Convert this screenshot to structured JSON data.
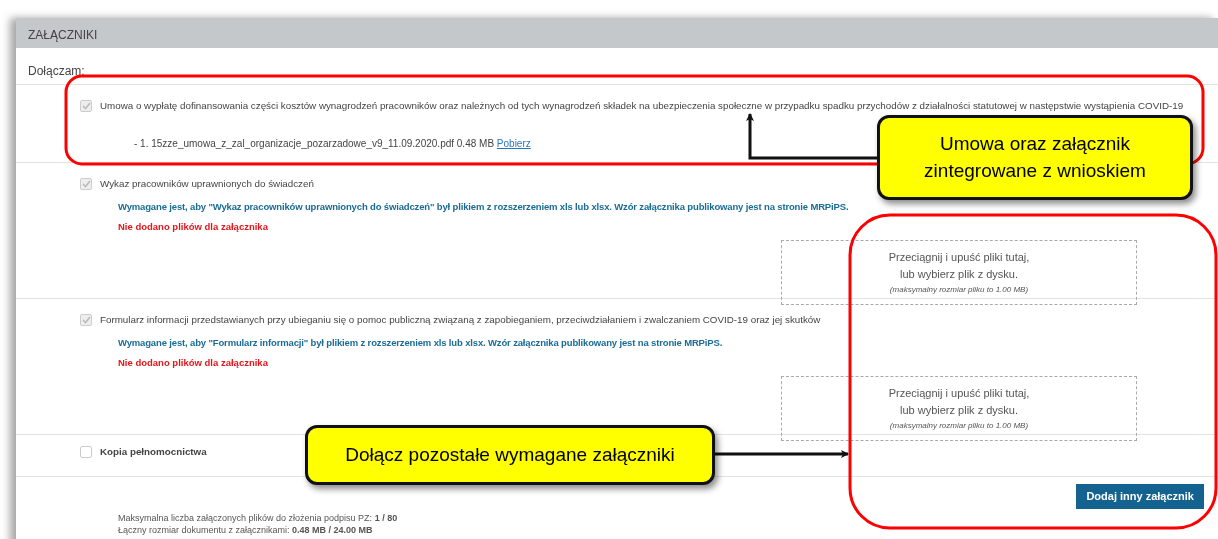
{
  "section": {
    "title": "ZAŁĄCZNIKI",
    "intro": "Dołączam:"
  },
  "attachments": [
    {
      "label": "Umowa o wypłatę dofinansowania części kosztów wynagrodzeń pracowników oraz należnych od tych wynagrodzeń składek na ubezpieczenia społeczne w przypadku spadku przychodów z działalności statutowej w następstwie wystąpienia COVID-19",
      "checked": true,
      "disabled": true,
      "files": [
        {
          "name": "- 1. 15zze_umowa_z_zal_organizacje_pozarzadowe_v9_11.09.2020.pdf 0.48 MB",
          "link": "Pobierz"
        }
      ]
    },
    {
      "label": "Wykaz pracowników uprawnionych do świadczeń",
      "checked": true,
      "disabled": true,
      "requirement": "Wymagane jest, aby \"Wykaz pracowników uprawnionych do świadczeń\" był plikiem z rozszerzeniem xls lub xlsx. Wzór załącznika publikowany jest na stronie MRPiPS.",
      "error": "Nie dodano plików dla załącznika",
      "dropzone": {
        "line1": "Przeciągnij i upuść pliki tutaj,",
        "pre": "lub",
        "link": "wybierz plik",
        "post": "z dysku.",
        "note": "(maksymalny rozmiar pliku to 1.00 MB)"
      }
    },
    {
      "label": "Formularz informacji przedstawianych przy ubieganiu się o pomoc publiczną związaną z zapobieganiem, przeciwdziałaniem i zwalczaniem COVID-19 oraz jej skutków",
      "checked": true,
      "disabled": true,
      "requirement": "Wymagane jest, aby \"Formularz informacji\" był plikiem z rozszerzeniem xls lub xlsx. Wzór załącznika publikowany jest na stronie MRPiPS.",
      "error": "Nie dodano plików dla załącznika",
      "dropzone": {
        "line1": "Przeciągnij i upuść pliki tutaj,",
        "pre": "lub",
        "link": "wybierz plik",
        "post": "z dysku.",
        "note": "(maksymalny rozmiar pliku to 1.00 MB)"
      }
    },
    {
      "label": "Kopia pełnomocnictwa",
      "checked": false,
      "disabled": false
    }
  ],
  "add_button": "Dodaj inny załącznik",
  "summary": [
    "Maksymalna liczba załączonych plików do złożenia podpisu PZ: **1 / 80**",
    "Łączny rozmiar dokumentu z załącznikami: **0.48 MB / 24.00 MB**"
  ],
  "annotations": [
    {
      "text": "Umowa oraz załącznik zintegrowane z wnioskiem"
    },
    {
      "text": "Dołącz pozostałe wymagane załączniki"
    }
  ]
}
